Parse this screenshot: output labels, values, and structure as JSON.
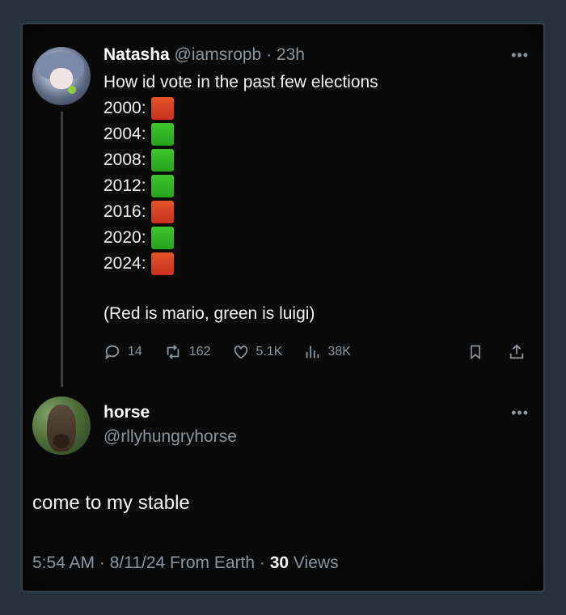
{
  "tweet": {
    "author_name": "Natasha",
    "author_handle": "@iamsropb",
    "time": "23h",
    "intro": "How id vote in the past few elections",
    "votes": [
      {
        "year": "2000:",
        "color": "red"
      },
      {
        "year": "2004:",
        "color": "green"
      },
      {
        "year": "2008:",
        "color": "green"
      },
      {
        "year": "2012:",
        "color": "green"
      },
      {
        "year": "2016:",
        "color": "red"
      },
      {
        "year": "2020:",
        "color": "green"
      },
      {
        "year": "2024:",
        "color": "red"
      }
    ],
    "note": "(Red is mario, green is luigi)",
    "stats": {
      "replies": "14",
      "reposts": "162",
      "likes": "5.1K",
      "views": "38K"
    }
  },
  "reply": {
    "author_name": "horse",
    "author_handle": "@rllyhungryhorse",
    "text": "come to my stable",
    "timestamp": "5:54 AM · 8/11/24 From Earth · ",
    "views_count": "30",
    "views_label": " Views"
  },
  "colors": {
    "red": "#d9432a",
    "green": "#2fb726",
    "muted": "#8b949c",
    "background": "#0a0a0a"
  }
}
